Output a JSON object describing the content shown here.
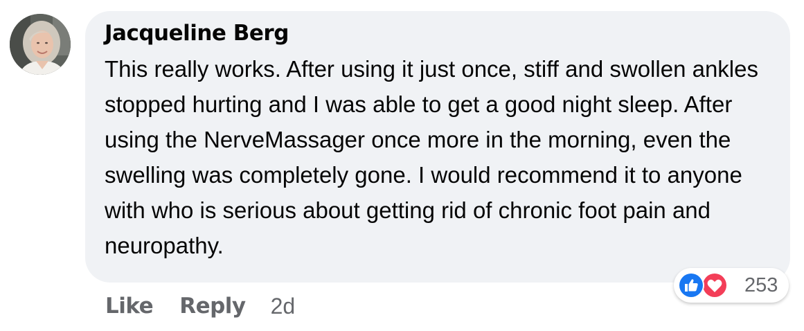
{
  "comment": {
    "author": "Jacqueline Berg",
    "text": "This really works. After using it just once, stiff and swollen ankles stopped hurting and I was able to get a good night sleep. After using the NerveMassager once more in the morning, even the swelling was completely gone. I would recommend it to anyone with who is serious about getting rid of chronic foot pain and neuropathy.",
    "reactions": {
      "icons": [
        "like-icon",
        "love-icon"
      ],
      "count": "253"
    },
    "actions": {
      "like_label": "Like",
      "reply_label": "Reply",
      "timestamp": "2d"
    }
  },
  "colors": {
    "bubble_bg": "#f0f2f5",
    "text": "#050505",
    "secondary_text": "#65676b",
    "like_blue": "#1877f2",
    "love_red": "#f33e58"
  }
}
